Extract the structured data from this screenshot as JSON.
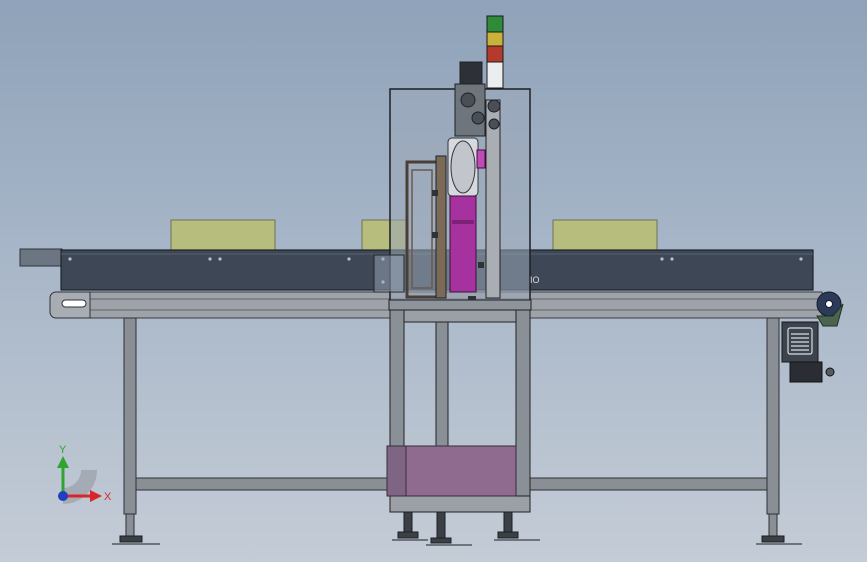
{
  "window": {
    "title": "",
    "background_top": "#8fa2b9",
    "background_bottom": "#c4ccd6"
  },
  "model": {
    "plate_text": "IO"
  },
  "triad": {
    "x_label": "X",
    "y_label": "Y",
    "x_color": "#d8262a",
    "y_color": "#2fa52f",
    "z_color": "#1f3fbf"
  },
  "colors": {
    "frame_steel": "#7b7f85",
    "conveyor_belt": "#3d4756",
    "product_box": "#b7bd7c",
    "bin": "#8e6b8f",
    "accent_magenta": "#a6329f",
    "signal_green": "#2f8a3a",
    "signal_yellow": "#c9b23a",
    "signal_red": "#b53a2e"
  },
  "icons": [
    "view-triad-icon",
    "motor-fan-icon"
  ]
}
